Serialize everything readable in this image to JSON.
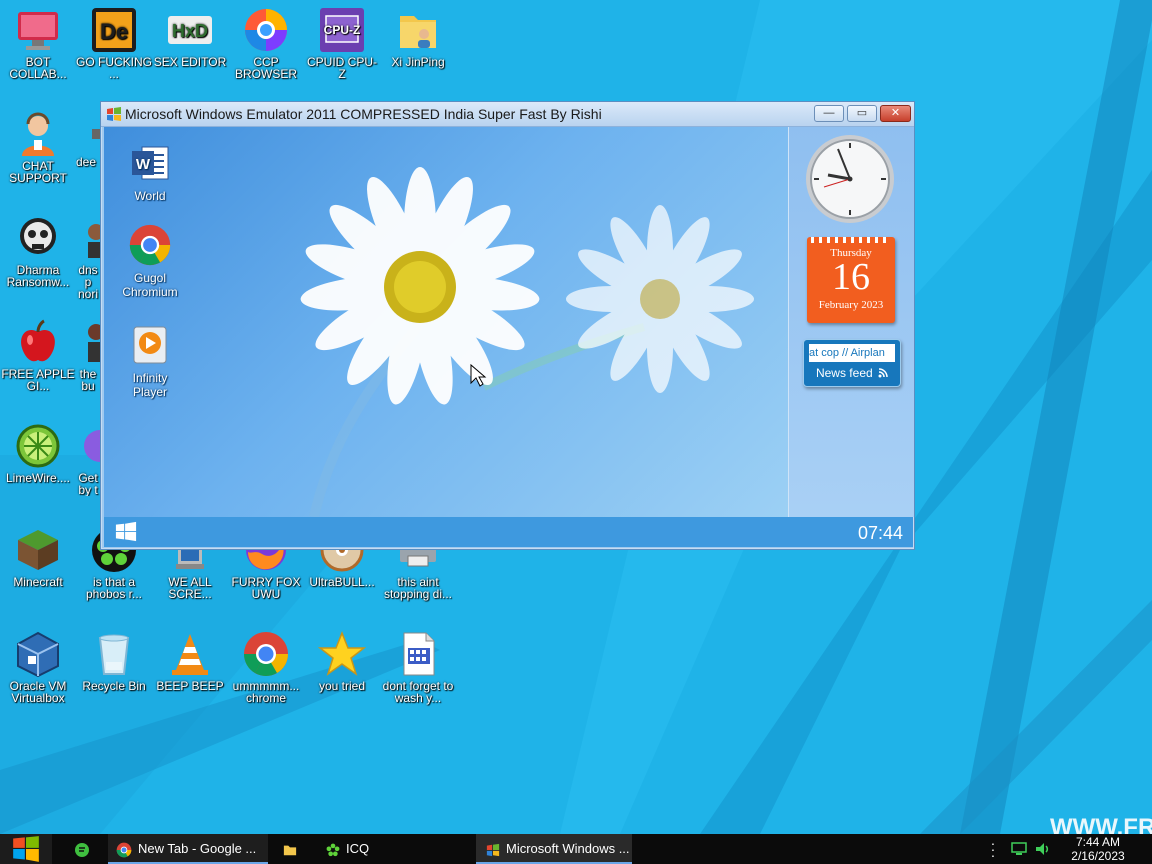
{
  "desktop": {
    "icons": [
      {
        "label": "BOT COLLAB...",
        "icon": "monitor-icon"
      },
      {
        "label": "GO FUCKING ...",
        "icon": "de-app-icon"
      },
      {
        "label": "SEX EDITOR",
        "icon": "hxd-icon"
      },
      {
        "label": "CCP BROWSER",
        "icon": "ccp-browser-icon"
      },
      {
        "label": "CPUID CPU-Z",
        "icon": "cpuz-icon"
      },
      {
        "label": "Xi JinPing",
        "icon": "user-folder-icon"
      },
      {
        "label": "CHAT SUPPORT",
        "icon": "support-person-icon"
      },
      {
        "label": "dee",
        "icon": "partial-icon"
      },
      {
        "label": "Dharma Ransomw...",
        "icon": "skull-icon"
      },
      {
        "label": "dnsp nori",
        "icon": "person-icon"
      },
      {
        "label": "FREE APPLE GI...",
        "icon": "apple-icon"
      },
      {
        "label": "the bu",
        "icon": "person-icon"
      },
      {
        "label": "LimeWire....",
        "icon": "limewire-icon"
      },
      {
        "label": "Get by t",
        "icon": "purple-icon"
      },
      {
        "label": "Minecraft",
        "icon": "minecraft-icon"
      },
      {
        "label": "is that a phobos r...",
        "icon": "icq-flower-icon"
      },
      {
        "label": "WE ALL SCRE...",
        "icon": "computer-icon"
      },
      {
        "label": "FURRY FOX UWU",
        "icon": "firefox-icon"
      },
      {
        "label": "UltraBULL...",
        "icon": "disc-icon"
      },
      {
        "label": "this aint stopping di...",
        "icon": "printer-icon"
      },
      {
        "label": "Oracle VM Virtualbox",
        "icon": "virtualbox-icon"
      },
      {
        "label": "Recycle Bin",
        "icon": "recycle-bin-icon"
      },
      {
        "label": "BEEP BEEP",
        "icon": "vlc-cone-icon"
      },
      {
        "label": "ummmmm... chrome",
        "icon": "chrome-icon"
      },
      {
        "label": "you tried",
        "icon": "star-icon"
      },
      {
        "label": "dont forget to wash y...",
        "icon": "document-icon"
      }
    ]
  },
  "emulator": {
    "title": "Microsoft Windows Emulator 2011 COMPRESSED India Super Fast By Rishi",
    "controls": {
      "minimize": "—",
      "maximize": "▭",
      "close": "✕"
    },
    "icons": [
      {
        "label": "World",
        "icon": "word-icon"
      },
      {
        "label": "Gugol Chromium",
        "icon": "chrome-icon"
      },
      {
        "label": "Infinity Player",
        "icon": "media-player-icon"
      }
    ],
    "clock_text": "07:44",
    "calendar": {
      "weekday": "Thursday",
      "day": "16",
      "month_year": "February 2023"
    },
    "news": {
      "ticker": "at cop // Airplan",
      "label": "News feed"
    }
  },
  "taskbar": {
    "tasks": [
      {
        "label": "New Tab - Google ...",
        "icon": "chrome-icon"
      },
      {
        "label": "",
        "icon": "folder-icon"
      },
      {
        "label": "ICQ",
        "icon": "icq-flower-icon"
      },
      {
        "label": "Microsoft Windows ...",
        "icon": "windows-flag-icon"
      }
    ],
    "time": "7:44 AM",
    "date": "2/16/2023"
  },
  "watermark": "WWW.FR",
  "colors": {
    "desktop": "#1fb3e8",
    "taskbar": "#0b0b0b",
    "emu_taskbar": "#3e99df",
    "calendar": "#f25e1f"
  }
}
